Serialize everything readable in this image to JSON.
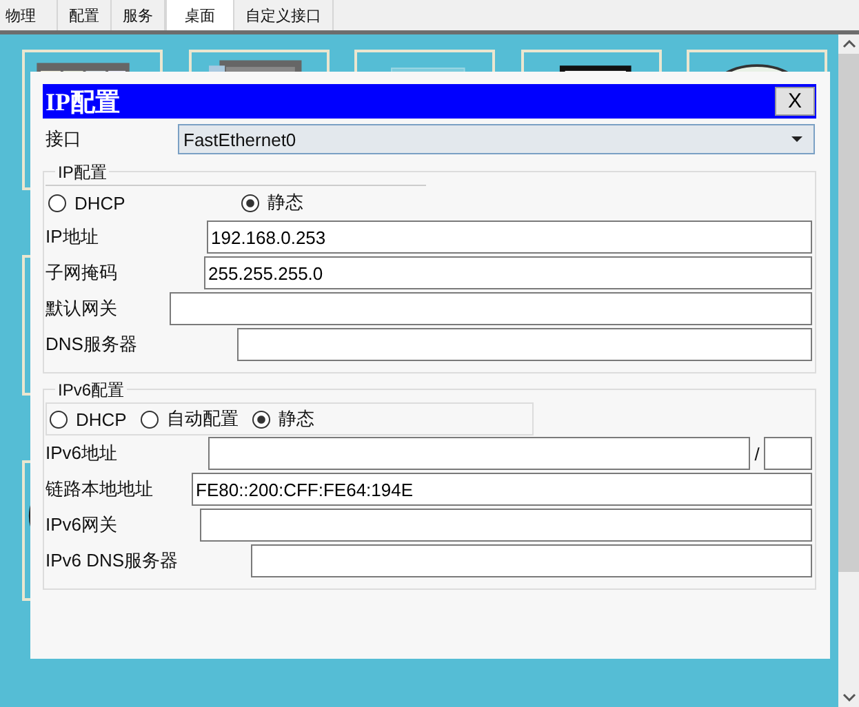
{
  "tabs": [
    {
      "label": "物理",
      "selected": false
    },
    {
      "label": "配置",
      "selected": false
    },
    {
      "label": "服务",
      "selected": false
    },
    {
      "label": "桌面",
      "selected": true
    },
    {
      "label": "自定义接口",
      "selected": false
    }
  ],
  "dialog": {
    "title": "IP配置",
    "close_label": "X",
    "interface": {
      "label": "接口",
      "value": "FastEthernet0"
    },
    "ipv4": {
      "legend": "IP配置",
      "modes": [
        {
          "label": "DHCP",
          "selected": false
        },
        {
          "label": "静态",
          "selected": true
        }
      ],
      "fields": [
        {
          "label": "IP地址",
          "value": "192.168.0.253"
        },
        {
          "label": "子网掩码",
          "value": "255.255.255.0"
        },
        {
          "label": "默认网关"
        },
        {
          "label": "DNS服务器"
        }
      ]
    },
    "ipv6": {
      "legend": "IPv6配置",
      "modes": [
        {
          "label": "DHCP",
          "selected": false
        },
        {
          "label": "自动配置",
          "selected": false
        },
        {
          "label": "静态",
          "selected": true
        }
      ],
      "fields": [
        {
          "label": "IPv6地址",
          "separator": "/"
        },
        {
          "label": "链路本地地址",
          "value": "FE80::200:CFF:FE64:194E"
        },
        {
          "label": "IPv6网关"
        },
        {
          "label": "IPv6 DNS服务器"
        }
      ]
    }
  }
}
